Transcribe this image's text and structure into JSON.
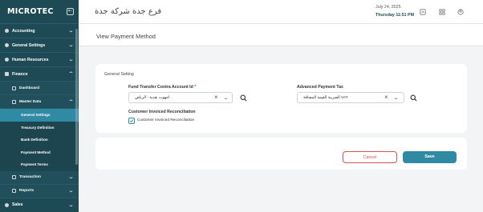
{
  "sidebar": {
    "logo": "MICROTEC",
    "items": [
      {
        "label": "Accounting"
      },
      {
        "label": "General Settings"
      },
      {
        "label": "Human Resources"
      },
      {
        "label": "Finance"
      }
    ],
    "finance": {
      "dashboard": "Dashboard",
      "master_data": "Master Data",
      "leaves": [
        "General Settings",
        "Treasury Definition",
        "Bank Definition",
        "Payment Method",
        "Payment Terms"
      ],
      "transaction": "Transaction",
      "reports": "Reports"
    },
    "sales": "Sales"
  },
  "header": {
    "company": "فرع جدة شركة جدة",
    "date": "July 24, 2025",
    "day_time": "Thursday  11:51 PM",
    "icons": [
      "box-icon",
      "grid-icon",
      "user-icon"
    ]
  },
  "page": {
    "title": "View Payment Method",
    "section_title": "General Setting",
    "fund_label": "Fund Transfer Contra Account Id",
    "fund_required": "*",
    "fund_value": "اجهوت نقدية - الرياض",
    "tax_label": "Advanced Payment Tax",
    "tax_value": "الضريبة القيمة المضافة VAT",
    "reconciliation_label": "Customer Invoiced Reconciliation",
    "reconciliation_check_label": "Customer Invoiced Reconciliation",
    "reconciliation_checked": true,
    "cancel_label": "Cancel",
    "save_label": "Save"
  },
  "colors": {
    "sidebar": "#1e4a55",
    "accent": "#2f8aa3",
    "danger": "#d9534f"
  }
}
